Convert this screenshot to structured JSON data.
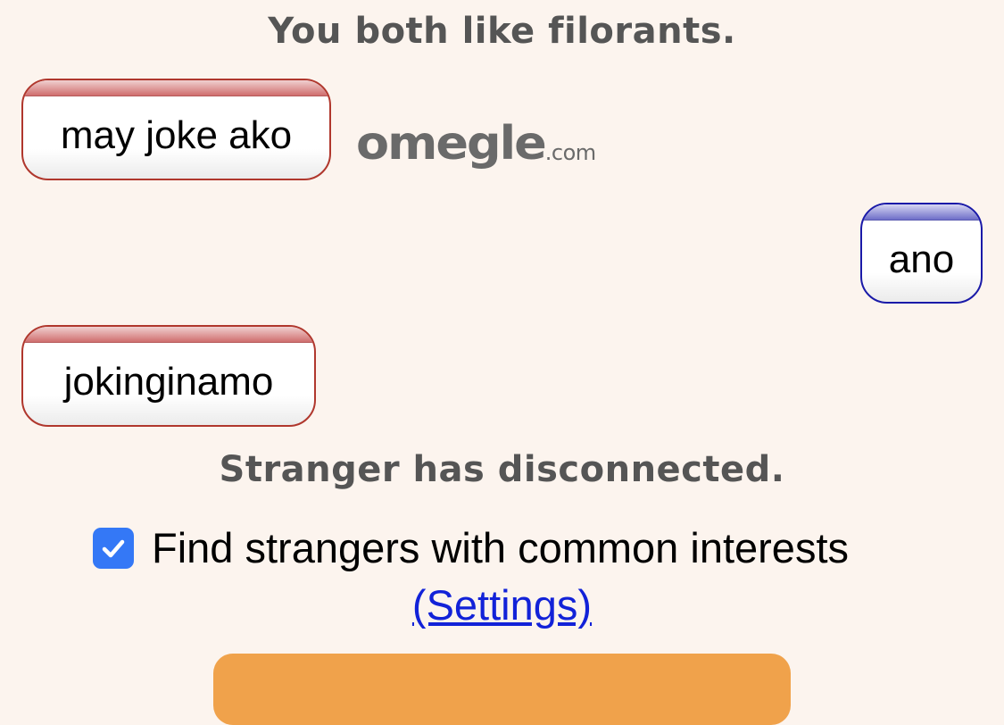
{
  "status": {
    "interests": "You both like filorants.",
    "disconnected": "Stranger has disconnected."
  },
  "logo": {
    "word": "omegle",
    "tld": ".com"
  },
  "messages": [
    {
      "sender": "stranger",
      "text": "may joke ako"
    },
    {
      "sender": "you",
      "text": "ano"
    },
    {
      "sender": "stranger",
      "text": "jokinginamo"
    }
  ],
  "interests": {
    "checked": true,
    "label": "Find strangers with common interests",
    "settings_link": "(Settings)"
  },
  "colors": {
    "background": "#fcf4ee",
    "stranger_border": "#b0372d",
    "you_border": "#1a1aa8",
    "checkbox": "#3478f6",
    "link": "#1222d8",
    "new_chat_button": "#f0a24b"
  },
  "icons": {
    "checkbox": "checkmark-icon"
  }
}
